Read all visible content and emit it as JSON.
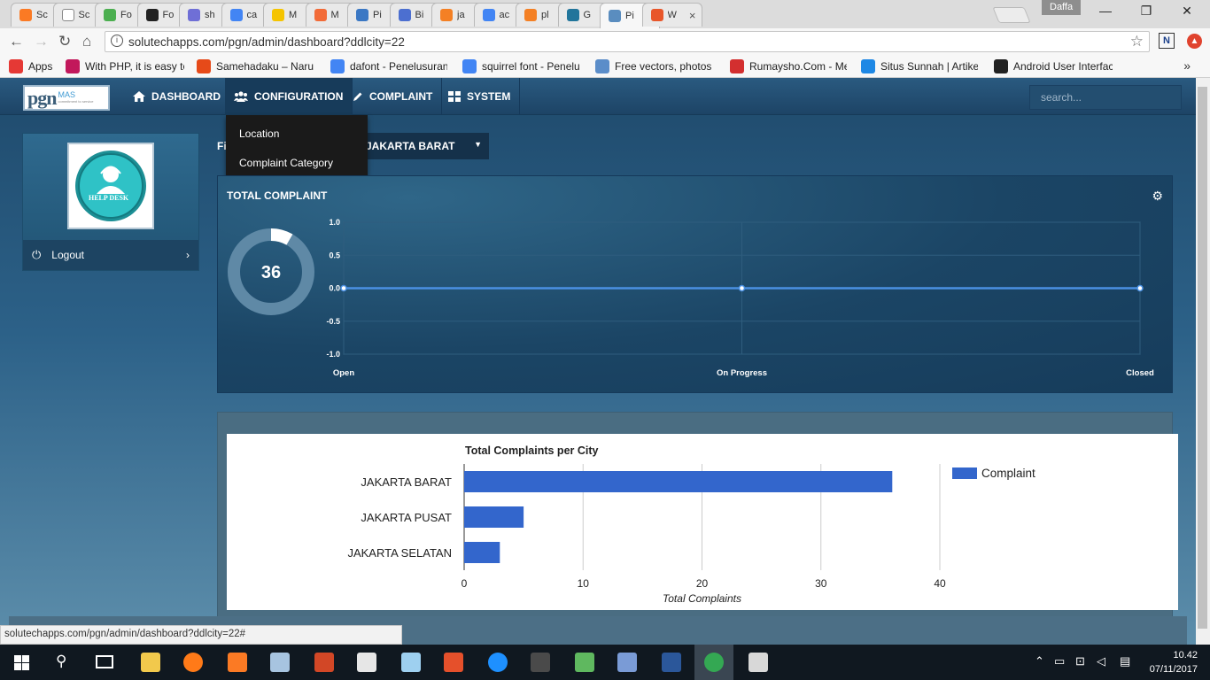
{
  "browser": {
    "tabs": [
      {
        "title": "Sc",
        "icon": "xampp-icon",
        "color": "#fb7a24"
      },
      {
        "title": "Sc",
        "icon": "page-icon",
        "color": "#ffffff"
      },
      {
        "title": "Fo",
        "icon": "w3-icon",
        "color": "#4caf50"
      },
      {
        "title": "Fo",
        "icon": "flag-icon",
        "color": "#222222"
      },
      {
        "title": "sh",
        "icon": "circle-icon",
        "color": "#6f6fd6"
      },
      {
        "title": "ca",
        "icon": "google-icon",
        "color": "#4285f4"
      },
      {
        "title": "M",
        "icon": "t-icon",
        "color": "#f5c400"
      },
      {
        "title": "M",
        "icon": "orange-icon",
        "color": "#f26b38"
      },
      {
        "title": "Pi",
        "icon": "shield-icon",
        "color": "#3b78c4"
      },
      {
        "title": "Bi",
        "icon": "chart-icon",
        "color": "#4c6fd0"
      },
      {
        "title": "ja",
        "icon": "stackoverflow-icon",
        "color": "#f48024"
      },
      {
        "title": "ac",
        "icon": "google-icon",
        "color": "#4285f4"
      },
      {
        "title": "pl",
        "icon": "stackoverflow-icon",
        "color": "#f48024"
      },
      {
        "title": "G",
        "icon": "wordpress-icon",
        "color": "#21759b"
      },
      {
        "title": "Pi",
        "icon": "page-icon",
        "color": "#5a8dbf"
      },
      {
        "title": "W",
        "icon": "alert-icon",
        "color": "#e8562a"
      }
    ],
    "user_badge": "Daffa",
    "url": "solutechapps.com/pgn/admin/dashboard?ddlcity=22",
    "bookmarks": [
      {
        "label": "Apps",
        "icon": "apps-icon",
        "color": "#e53935"
      },
      {
        "label": "With PHP, it is easy to",
        "icon": "s-icon",
        "color": "#c2185b"
      },
      {
        "label": "Samehadaku – Naruto",
        "icon": "s-icon",
        "color": "#e64a19"
      },
      {
        "label": "dafont - Penelusuran",
        "icon": "google-icon",
        "color": "#4285f4"
      },
      {
        "label": "squirrel font - Penelu",
        "icon": "google-icon",
        "color": "#4285f4"
      },
      {
        "label": "Free vectors, photos a",
        "icon": "freepik-icon",
        "color": "#5b8dc9"
      },
      {
        "label": "Rumaysho.Com - Me",
        "icon": "r-icon",
        "color": "#d32f2f"
      },
      {
        "label": "Situs Sunnah | Artikel",
        "icon": "wave-icon",
        "color": "#1e88e5"
      },
      {
        "label": "Android User Interfac",
        "icon": "v-icon",
        "color": "#222222"
      }
    ],
    "more_bookmarks": "»",
    "status_url": "solutechapps.com/pgn/admin/dashboard?ddlcity=22#"
  },
  "app": {
    "logo_text": "pgn",
    "logo_mas": "MAS",
    "logo_tagline": "commitment to service",
    "nav": [
      {
        "label": "DASHBOARD",
        "icon": "home-icon"
      },
      {
        "label": "CONFIGURATION",
        "icon": "users-icon"
      },
      {
        "label": "COMPLAINT",
        "icon": "pencil-icon"
      },
      {
        "label": "SYSTEM",
        "icon": "grid-icon"
      }
    ],
    "search_placeholder": "search...",
    "config_menu": [
      "Location",
      "Complaint Category"
    ],
    "avatar_caption": "HELP DESK",
    "logout_label": "Logout",
    "filter_label": "Fi",
    "city_selected": "JAKARTA BARAT",
    "total_panel_title": "TOTAL COMPLAINT",
    "total_count": "36",
    "donut_fraction": 0.083
  },
  "chart_data": [
    {
      "type": "line",
      "categories": [
        "Open",
        "On Progress",
        "Closed"
      ],
      "values": [
        0,
        0,
        0
      ],
      "ylim": [
        -1.0,
        1.0
      ],
      "yticks": [
        "1.0",
        "0.5",
        "0.0",
        "-0.5",
        "-1.0"
      ],
      "title": "",
      "grid": true
    },
    {
      "type": "bar",
      "orientation": "horizontal",
      "title": "Total Complaints per City",
      "categories": [
        "JAKARTA BARAT",
        "JAKARTA PUSAT",
        "JAKARTA SELATAN"
      ],
      "series": [
        {
          "name": "Complaint",
          "values": [
            36,
            5,
            3
          ]
        }
      ],
      "xlabel": "Total Complaints",
      "xlim": [
        0,
        40
      ],
      "xticks": [
        "0",
        "10",
        "20",
        "30",
        "40"
      ],
      "legend": "right",
      "color": "#3366cc"
    }
  ],
  "taskbar": {
    "time": "10.42",
    "date": "07/11/2017",
    "apps": [
      {
        "name": "file-explorer-icon",
        "color": "#f2c94c"
      },
      {
        "name": "firefox-icon",
        "color": "#ff7a18"
      },
      {
        "name": "xampp-icon",
        "color": "#fb7a24"
      },
      {
        "name": "notepad-icon",
        "color": "#a7c4e0"
      },
      {
        "name": "powerpoint-icon",
        "color": "#d24726"
      },
      {
        "name": "excel-icon",
        "color": "#e6e6e6"
      },
      {
        "name": "notepadpp-icon",
        "color": "#9ed0f0"
      },
      {
        "name": "filezilla-icon",
        "color": "#e5502b"
      },
      {
        "name": "edge-icon",
        "color": "#1e90ff"
      },
      {
        "name": "sublime-icon",
        "color": "#4a4a4a"
      },
      {
        "name": "git-icon",
        "color": "#5fb85f"
      },
      {
        "name": "network-icon",
        "color": "#7a9bd6"
      },
      {
        "name": "word-icon",
        "color": "#2b579a"
      },
      {
        "name": "chrome-icon",
        "color": "#34a853"
      },
      {
        "name": "snipping-icon",
        "color": "#d8d8d8"
      }
    ]
  }
}
